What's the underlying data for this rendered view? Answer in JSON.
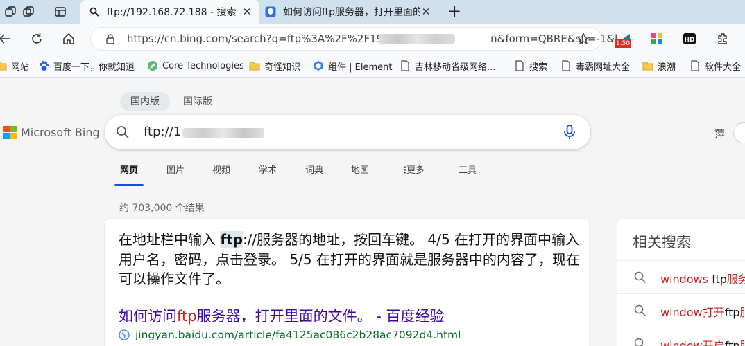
{
  "tabs": [
    {
      "title": "ftp://192.168.72.188 - 搜索",
      "active": true
    },
    {
      "title": "如何访问ftp服务器，打开里面的文",
      "active": false
    }
  ],
  "address": {
    "url": "https://cn.bing.com/search?q=ftp%3A%2F%2F192.168",
    "url_tail": "n&form=QBRE&sp=-1&l..."
  },
  "extensions": {
    "badge": "1.50"
  },
  "bookmarks": [
    "网站",
    "百度一下，你就知道",
    "Core Technologies",
    "奇怪知识",
    "组件 | Element",
    "吉林移动省级网络...",
    "搜索",
    "毒霸网址大全",
    "浪潮",
    "软件大全"
  ],
  "bing": {
    "region_active": "国内版",
    "region_other": "国际版",
    "logo_text": "Microsoft Bing",
    "query_visible": "ftp://1",
    "user_name": "萍",
    "nav": [
      "网页",
      "图片",
      "视频",
      "学术",
      "词典",
      "地图",
      "更多",
      "工具"
    ],
    "result_count": "约 703,000 个结果",
    "snippet": {
      "before": "在地址栏中输入 ",
      "highlight": "ftp",
      "after": "://服务器的地址，按回车键。 4/5 在打开的界面中输入 用户名，密码，点击登录。 5/5 在打开的界面就是服务器中的内容了，现在可以操作文件了。"
    },
    "result": {
      "title_pre": "如何访问",
      "title_kw": "ftp",
      "title_post": "服务器，打开里面的文件。 - 百度经验",
      "url": "jingyan.baidu.com/article/fa4125ac086c2b28ac7092d4.html"
    },
    "related": {
      "title": "相关搜索",
      "items": [
        {
          "red1": "windows ",
          "plain": "ftp",
          "red2": "服务"
        },
        {
          "red1": "window打开",
          "plain": "ftp",
          "red2": "服"
        },
        {
          "red1": "window开启",
          "plain": "ftp",
          "red2": "服"
        }
      ]
    }
  },
  "colors": {
    "accent": "#174ae4",
    "title_link": "#4007a2",
    "url_green": "#006d21",
    "keyword_red": "#c5221f"
  }
}
